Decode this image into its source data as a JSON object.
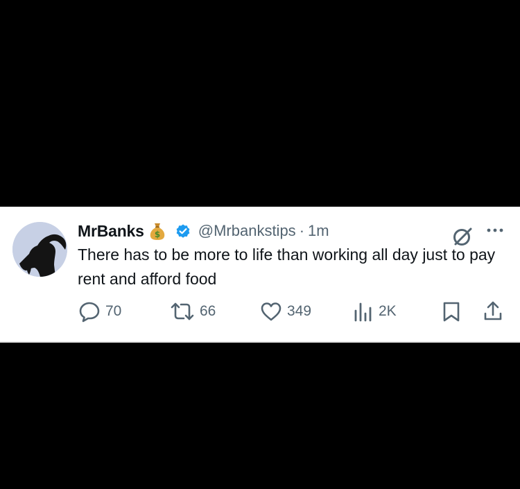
{
  "tweet": {
    "display_name": "MrBanks",
    "handle": "@Mrbankstips",
    "separator": "·",
    "time": "1m",
    "text": "There has to be more to life than working all day just to pay rent and afford food"
  },
  "actions": {
    "replies": "70",
    "reposts": "66",
    "likes": "349",
    "views": "2K"
  },
  "icons": {
    "badge": "moneybag-icon",
    "verified": "verified-icon",
    "grok": "grok-icon",
    "more": "more-icon",
    "reply": "reply-icon",
    "repost": "repost-icon",
    "like": "heart-icon",
    "views": "views-icon",
    "bookmark": "bookmark-icon",
    "share": "share-icon"
  },
  "colors": {
    "background": "#000000",
    "card": "#ffffff",
    "text": "#0f1419",
    "secondary": "#536471",
    "verified": "#1d9bf0"
  }
}
